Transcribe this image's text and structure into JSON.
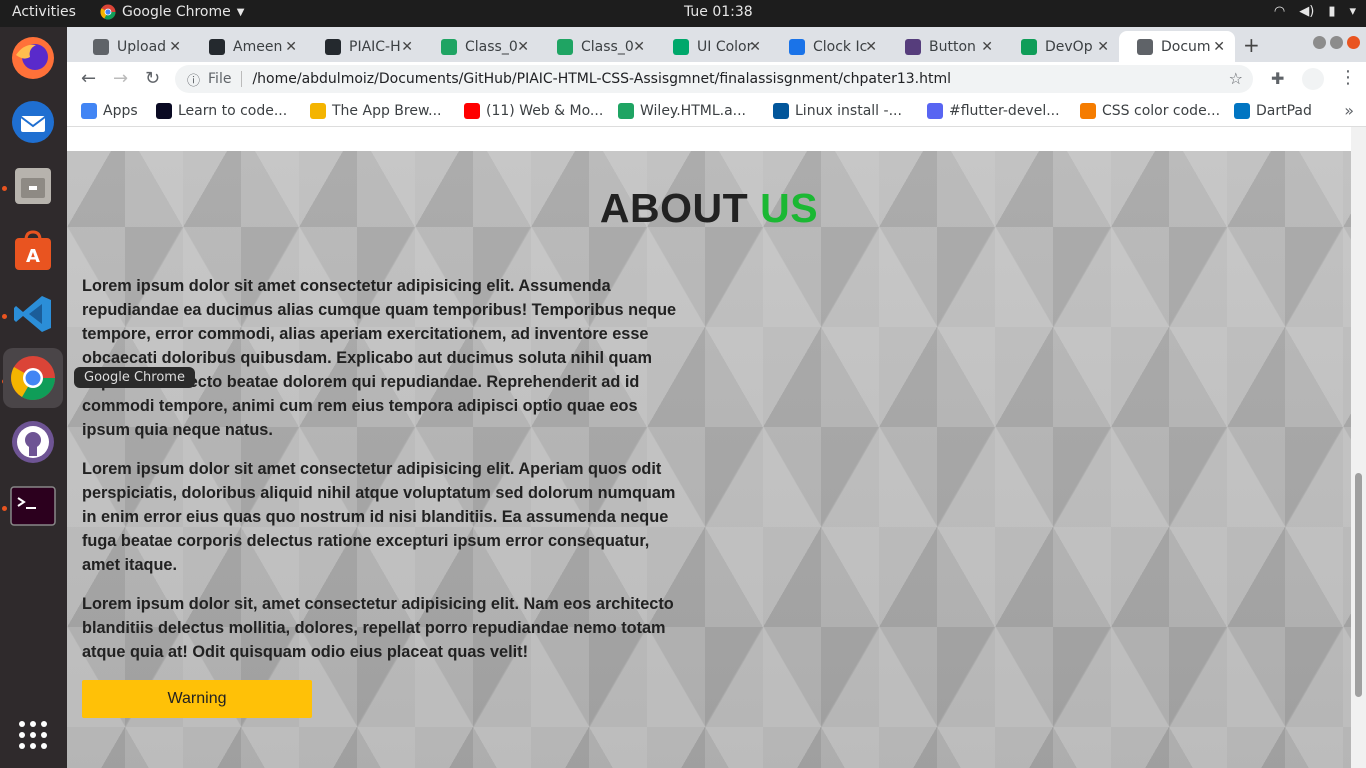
{
  "topbar": {
    "activities": "Activities",
    "app_name": "Google Chrome",
    "clock": "Tue 01:38"
  },
  "dock": {
    "tooltip": "Google Chrome",
    "apps": [
      "firefox",
      "thunderbird",
      "files",
      "software",
      "vscode",
      "chrome",
      "github-desktop",
      "terminal",
      "show-apps"
    ]
  },
  "tabs": [
    {
      "label": "Upload",
      "icon": "upload-icon",
      "color": "#5f6368"
    },
    {
      "label": "Ameen",
      "icon": "github-icon",
      "color": "#24292e"
    },
    {
      "label": "PIAIC-H",
      "icon": "github-icon",
      "color": "#24292e"
    },
    {
      "label": "Class_0",
      "icon": "drive-icon",
      "color": "#1fa463"
    },
    {
      "label": "Class_0",
      "icon": "drive-icon",
      "color": "#1fa463"
    },
    {
      "label": "UI Color",
      "icon": "ui-color-icon",
      "color": "#00a86b"
    },
    {
      "label": "Clock Ic",
      "icon": "flag-icon",
      "color": "#1a73e8"
    },
    {
      "label": "Button",
      "icon": "bootstrap-icon",
      "color": "#563d7c"
    },
    {
      "label": "DevOp",
      "icon": "leaf-icon",
      "color": "#0f9d58"
    },
    {
      "label": "Docum",
      "icon": "globe-icon",
      "color": "#5f6368"
    }
  ],
  "omnibox": {
    "scheme_label": "File",
    "url": "/home/abdulmoiz/Documents/GitHub/PIAIC-HTML-CSS-Assisgmnet/finalassisgnment/chpater13.html"
  },
  "bookmarks": [
    {
      "label": "Apps",
      "color": "#4285f4"
    },
    {
      "label": "Learn to code...",
      "color": "#0a0a23"
    },
    {
      "label": "The App Brew...",
      "color": "#f4b400"
    },
    {
      "label": "(11) Web & Mo...",
      "color": "#ff0000"
    },
    {
      "label": "Wiley.HTML.a...",
      "color": "#1fa463"
    },
    {
      "label": "Linux install -...",
      "color": "#02569b"
    },
    {
      "label": "#flutter-devel...",
      "color": "#5865f2"
    },
    {
      "label": "CSS color code...",
      "color": "#f57c00"
    },
    {
      "label": "DartPad",
      "color": "#0175c2"
    }
  ],
  "page": {
    "heading_main": "ABOUT",
    "heading_accent": "US",
    "accent_color": "#1bb833",
    "paragraphs": [
      "Lorem ipsum dolor sit amet consectetur adipisicing elit. Assumenda repudiandae ea ducimus alias cumque quam temporibus! Temporibus neque tempore, error commodi, alias aperiam exercitationem, ad inventore esse obcaecati doloribus quibusdam. Explicabo aut ducimus soluta nihil quam impedit architecto beatae dolorem qui repudiandae. Reprehenderit ad id commodi tempore, animi cum rem eius tempora adipisci optio quae eos ipsum quia neque natus.",
      "Lorem ipsum dolor sit amet consectetur adipisicing elit. Aperiam quos odit perspiciatis, doloribus aliquid nihil atque voluptatum sed dolorum numquam in enim error eius quas quo nostrum id nisi blanditiis. Ea assumenda neque fuga beatae corporis delectus ratione excepturi ipsum error consequatur, amet itaque.",
      "Lorem ipsum dolor sit, amet consectetur adipisicing elit. Nam eos architecto blanditiis delectus mollitia, dolores, repellat porro repudiandae nemo totam atque quia at! Odit quisquam odio eius placeat quas velit!"
    ],
    "button_label": "Warning",
    "button_color": "#ffc107"
  },
  "scroll": {
    "position_fraction": 0.83,
    "visible_fraction": 0.35
  }
}
